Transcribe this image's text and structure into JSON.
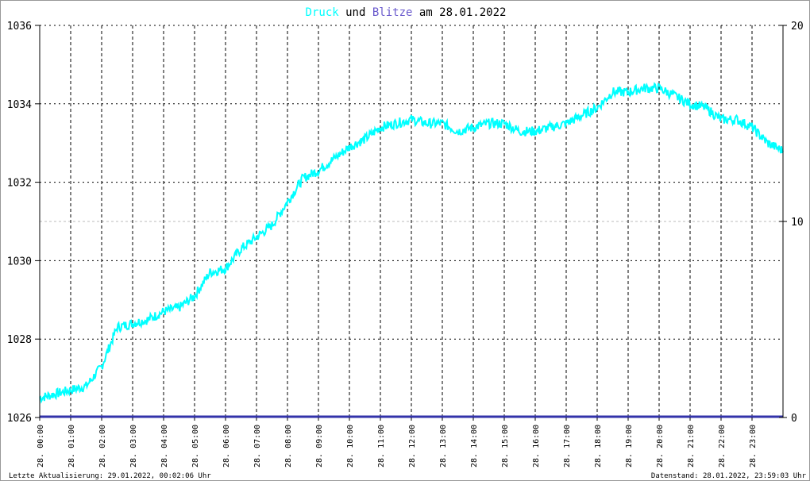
{
  "chart_data": {
    "type": "line",
    "title_parts": [
      "Druck",
      "und",
      "Blitze",
      "am 28.01.2022"
    ],
    "title_colors": [
      "#00ffff",
      "#000000",
      "#6a5acd",
      "#000000"
    ],
    "x_labels": [
      "28. 00:00",
      "28. 01:00",
      "28. 02:00",
      "28. 03:00",
      "28. 04:00",
      "28. 05:00",
      "28. 06:00",
      "28. 07:00",
      "28. 08:00",
      "28. 09:00",
      "28. 10:00",
      "28. 11:00",
      "28. 12:00",
      "28. 13:00",
      "28. 14:00",
      "28. 15:00",
      "28. 16:00",
      "28. 17:00",
      "28. 18:00",
      "28. 19:00",
      "28. 20:00",
      "28. 21:00",
      "28. 22:00",
      "28. 23:00"
    ],
    "xlim_hours": [
      0,
      24
    ],
    "y_left": {
      "range": [
        1026,
        1036
      ],
      "ticks": [
        "1026",
        "1028",
        "1030",
        "1032",
        "1034",
        "1036"
      ],
      "tick_values": [
        1026,
        1028,
        1030,
        1032,
        1034,
        1036
      ]
    },
    "y_right": {
      "range": [
        0,
        20
      ],
      "ticks": [
        "0",
        "10",
        "20"
      ],
      "tick_values": [
        0,
        10,
        20
      ]
    },
    "series": [
      {
        "name": "Druck",
        "color": "#00ffff",
        "axis": "left",
        "x_hours": [
          0,
          0.5,
          1,
          1.5,
          2,
          2.5,
          3,
          3.5,
          4,
          4.5,
          5,
          5.5,
          6,
          6.5,
          7,
          7.5,
          8,
          8.5,
          9,
          9.5,
          10,
          10.5,
          11,
          11.5,
          12,
          12.5,
          13,
          13.5,
          14,
          14.5,
          15,
          15.5,
          16,
          16.5,
          17,
          17.5,
          18,
          18.5,
          19,
          19.5,
          20,
          20.5,
          21,
          21.5,
          22,
          22.5,
          23,
          23.5,
          24
        ],
        "values": [
          1026.5,
          1026.6,
          1026.7,
          1026.8,
          1027.3,
          1028.3,
          1028.4,
          1028.5,
          1028.7,
          1028.8,
          1029.1,
          1029.7,
          1029.8,
          1030.3,
          1030.6,
          1030.9,
          1031.5,
          1032.1,
          1032.3,
          1032.6,
          1032.9,
          1033.1,
          1033.4,
          1033.5,
          1033.6,
          1033.5,
          1033.5,
          1033.3,
          1033.4,
          1033.5,
          1033.5,
          1033.3,
          1033.3,
          1033.4,
          1033.5,
          1033.7,
          1033.9,
          1034.3,
          1034.3,
          1034.4,
          1034.4,
          1034.2,
          1034.0,
          1033.9,
          1033.6,
          1033.6,
          1033.4,
          1033.0,
          1032.8
        ]
      },
      {
        "name": "Blitze",
        "color": "#3333aa",
        "axis": "right",
        "x_hours": [
          0,
          24
        ],
        "values": [
          0,
          0
        ]
      }
    ]
  },
  "footer": {
    "left": "Letzte Aktualisierung: 29.01.2022, 00:02:06 Uhr",
    "right": "Datenstand: 28.01.2022, 23:59:03 Uhr"
  }
}
